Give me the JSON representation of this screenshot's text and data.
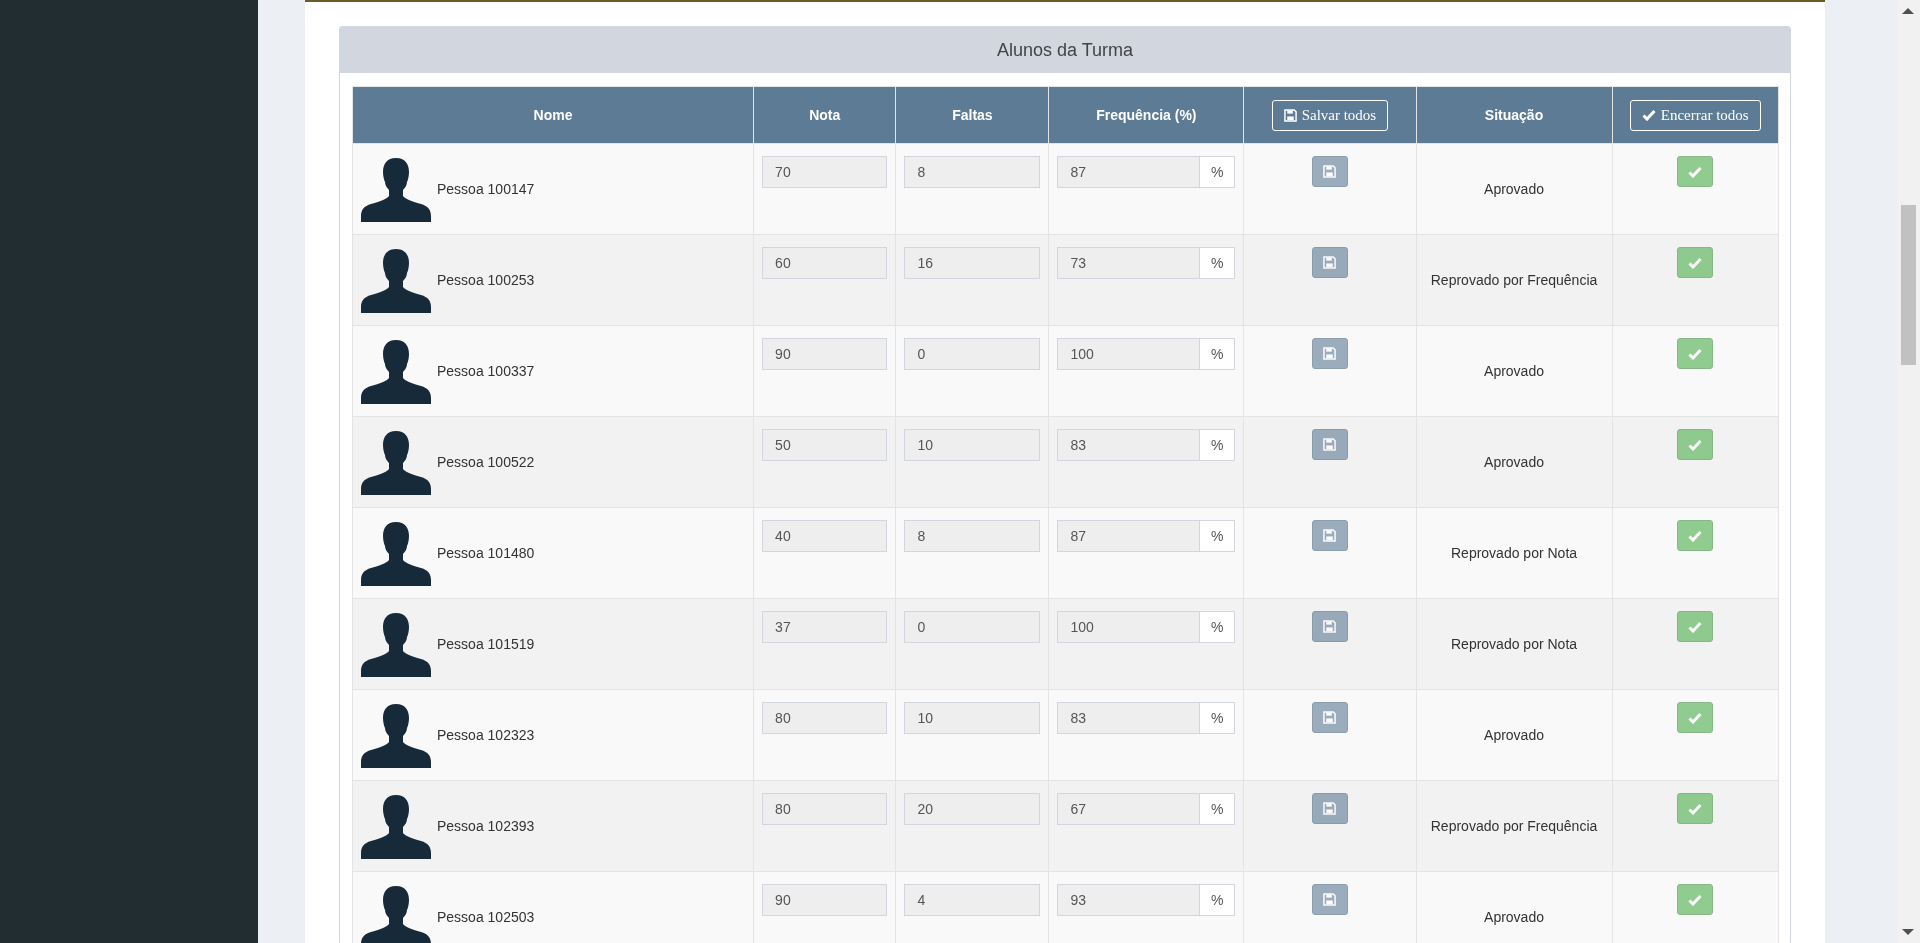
{
  "card": {
    "title": "Alunos da Turma"
  },
  "table": {
    "columns": [
      {
        "kind": "text",
        "label": "Nome"
      },
      {
        "kind": "text",
        "label": "Nota"
      },
      {
        "kind": "text",
        "label": "Faltas"
      },
      {
        "kind": "text",
        "label": "Frequência (%)"
      },
      {
        "kind": "save",
        "label": "Salvar todos"
      },
      {
        "kind": "text",
        "label": "Situação"
      },
      {
        "kind": "close",
        "label": "Encerrar todos"
      }
    ],
    "rows": [
      {
        "name": "Pessoa 100147",
        "nota": "70",
        "faltas": "8",
        "frequencia": "87",
        "unit": "%",
        "situacao": "Aprovado",
        "disabled": true
      },
      {
        "name": "Pessoa 100253",
        "nota": "60",
        "faltas": "16",
        "frequencia": "73",
        "unit": "%",
        "situacao": "Reprovado por Frequência",
        "disabled": true
      },
      {
        "name": "Pessoa 100337",
        "nota": "90",
        "faltas": "0",
        "frequencia": "100",
        "unit": "%",
        "situacao": "Aprovado",
        "disabled": true
      },
      {
        "name": "Pessoa 100522",
        "nota": "50",
        "faltas": "10",
        "frequencia": "83",
        "unit": "%",
        "situacao": "Aprovado",
        "disabled": true
      },
      {
        "name": "Pessoa 101480",
        "nota": "40",
        "faltas": "8",
        "frequencia": "87",
        "unit": "%",
        "situacao": "Reprovado por Nota",
        "disabled": true
      },
      {
        "name": "Pessoa 101519",
        "nota": "37",
        "faltas": "0",
        "frequencia": "100",
        "unit": "%",
        "situacao": "Reprovado por Nota",
        "disabled": true
      },
      {
        "name": "Pessoa 102323",
        "nota": "80",
        "faltas": "10",
        "frequencia": "83",
        "unit": "%",
        "situacao": "Aprovado",
        "disabled": true
      },
      {
        "name": "Pessoa 102393",
        "nota": "80",
        "faltas": "20",
        "frequencia": "67",
        "unit": "%",
        "situacao": "Reprovado por Frequência",
        "disabled": true
      },
      {
        "name": "Pessoa 102503",
        "nota": "90",
        "faltas": "4",
        "frequencia": "93",
        "unit": "%",
        "situacao": "Aprovado",
        "disabled": true
      }
    ]
  }
}
